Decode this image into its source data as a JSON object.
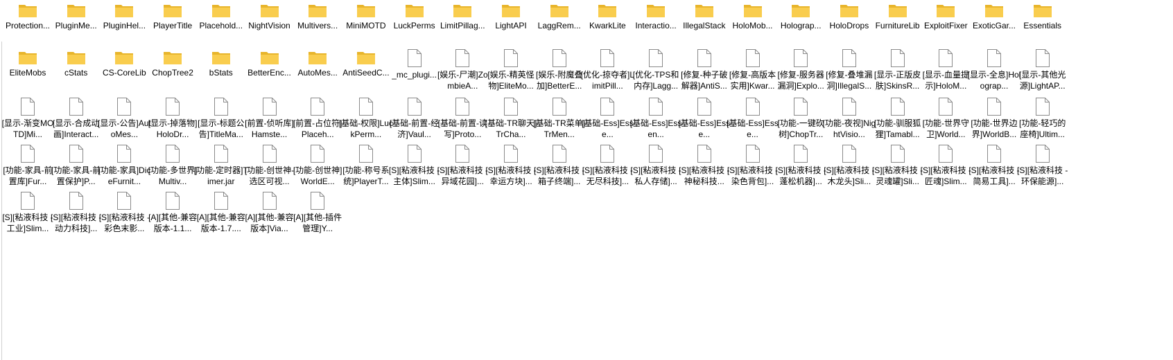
{
  "explorer": {
    "folders": [
      "Protection...",
      "PluginMe...",
      "PluginHel...",
      "PlayerTitle",
      "Placehold...",
      "NightVision",
      "Multivers...",
      "MiniMOTD",
      "LuckPerms",
      "LimitPillag...",
      "LightAPI",
      "LaggRem...",
      "KwarkLite",
      "Interactio...",
      "IllegalStack",
      "HoloMob...",
      "Holograp...",
      "HoloDrops",
      "FurnitureLib",
      "ExploitFixer",
      "ExoticGar...",
      "Essentials",
      "EliteMobs",
      "cStats",
      "CS-CoreLib",
      "ChopTree2",
      "bStats",
      "BetterEnc...",
      "AutoMes...",
      "AntiSeedC..."
    ],
    "files": [
      "_mc_plugi...",
      "[娱乐-尸潮]ZombieA...",
      "[娱乐-精英怪物]EliteMo...",
      "[娱乐-附魔叠加]BetterE...",
      "[优化-掠夺者]LimitPill...",
      "[优化-TPS和内存]Lagg...",
      "[修复-种子破解器]AntiS...",
      "[修复-高版本实用]Kwar...",
      "[修复-服务器漏洞]Explo...",
      "[修复-叠堆漏洞]IllegalS...",
      "[显示-正版皮肤]SkinsR...",
      "[显示-血量提示]HoloM...",
      "[显示-全息]Holograp...",
      "[显示-其他光源]LightAP...",
      "[显示-渐变MOTD]Mi...",
      "[显示-合成动画]Interact...",
      "[显示-公告]AutoMes...",
      "[显示-掉落物]HoloDr...",
      "[显示-标题公告]TitleMa...",
      "[前置-侦听库]Hamste...",
      "[前置-占位符]Placeh...",
      "[基础-权限]LuckPerm...",
      "[基础-前置-经济]Vaul...",
      "[基础-前置-读写]Proto...",
      "[基础-TR聊天]TrCha...",
      "[基础-TR菜单]TrMen...",
      "[基础-Ess]Esse...",
      "[基础-Ess]Essen...",
      "[基础-Ess]Esse...",
      "[基础-Ess]Esse...",
      "[功能-一键砍树]ChopTr...",
      "[功能-夜视]NightVisio...",
      "[功能-驯服狐狸]Tamabl...",
      "[功能-世界守卫]World...",
      "[功能-世界边界]WorldB...",
      "[功能-轻巧的座椅]Ultim...",
      "[功能-家具-前置库]Fur...",
      "[功能-家具-前置保护]P...",
      "[功能-家具]DiceFurnit...",
      "[功能-多世界]Multiv...",
      "[功能-定时器]Timer.jar",
      "[功能-创世神-选区可视...",
      "[功能-创世神]WorldE...",
      "[功能-称号系统]PlayerT...",
      "[S][粘液科技 - 主体]Slim...",
      "[S][粘液科技 - 异域花园]...",
      "[S][粘液科技 - 幸运方块]...",
      "[S][粘液科技 - 箱子终端]...",
      "[S][粘液科技 - 无尽科技]...",
      "[S][粘液科技 - 私人存储]...",
      "[S][粘液科技 - 神秘科技...",
      "[S][粘液科技 - 染色背包]...",
      "[S][粘液科技 - 蓬松机器]...",
      "[S][粘液科技 - 木龙头]Sli...",
      "[S][粘液科技 - 灵魂罐]Sli...",
      "[S][粘液科技 - 匠魂]Slim...",
      "[S][粘液科技 - 简易工具]...",
      "[S][粘液科技 - 环保能源]...",
      "[S][粘液科技 - 工业]Slim...",
      "[S][粘液科技 - 动力科技]...",
      "[S][粘液科技 - 彩色末影...",
      "[A][其他-兼容版本-1.1...",
      "[A][其他-兼容版本-1.7....",
      "[A][其他-兼容版本]Via...",
      "[A][其他-插件管理]Y..."
    ],
    "colors": {
      "folder_back": "#e8b52c",
      "folder_front": "#f9cd4e",
      "file_page": "#ffffff",
      "file_border": "#8a8a8a"
    },
    "icons": {
      "folder": "folder-icon",
      "file": "file-icon"
    }
  }
}
